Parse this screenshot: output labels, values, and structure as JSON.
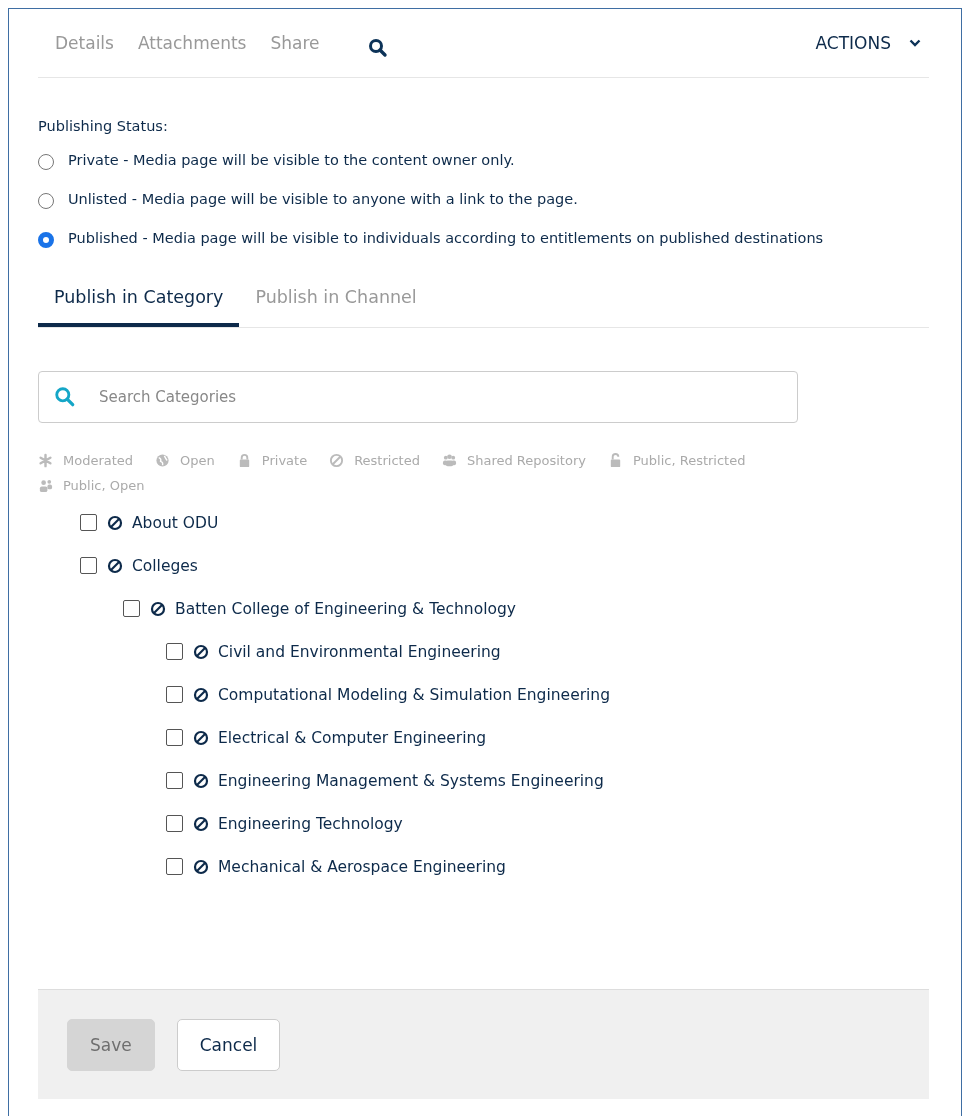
{
  "top_tabs": [
    {
      "label": "Details",
      "selected": false
    },
    {
      "label": "Attachments",
      "selected": false
    },
    {
      "label": "Share",
      "selected": false
    }
  ],
  "actions": {
    "label": "ACTIONS"
  },
  "publishing_status": {
    "label": "Publishing Status:",
    "options": [
      {
        "label": "Private - Media page will be visible to the content owner only.",
        "selected": false
      },
      {
        "label": "Unlisted - Media page will be visible to anyone with a link to the page.",
        "selected": false
      },
      {
        "label": "Published - Media page will be visible to individuals according to entitlements on published destinations",
        "selected": true
      }
    ]
  },
  "publish_tabs": [
    {
      "label": "Publish in Category",
      "selected": true
    },
    {
      "label": "Publish in Channel",
      "selected": false
    }
  ],
  "search": {
    "placeholder": "Search Categories"
  },
  "legend": [
    {
      "kind": "moderated",
      "label": "Moderated"
    },
    {
      "kind": "open",
      "label": "Open"
    },
    {
      "kind": "private",
      "label": "Private"
    },
    {
      "kind": "restricted",
      "label": "Restricted"
    },
    {
      "kind": "shared",
      "label": "Shared Repository"
    },
    {
      "kind": "public_restricted",
      "label": "Public, Restricted"
    },
    {
      "kind": "public_open",
      "label": "Public, Open"
    }
  ],
  "categories": [
    {
      "label": "About ODU",
      "kind": "restricted",
      "checked": false
    },
    {
      "label": "Colleges",
      "kind": "restricted",
      "checked": false,
      "children": [
        {
          "label": "Batten College of Engineering & Technology",
          "kind": "restricted",
          "checked": false,
          "children": [
            {
              "label": "Civil and Environmental Engineering",
              "kind": "restricted",
              "checked": false
            },
            {
              "label": "Computational Modeling & Simulation Engineering",
              "kind": "restricted",
              "checked": false
            },
            {
              "label": "Electrical & Computer Engineering",
              "kind": "restricted",
              "checked": false
            },
            {
              "label": "Engineering Management & Systems Engineering",
              "kind": "restricted",
              "checked": false
            },
            {
              "label": "Engineering Technology",
              "kind": "restricted",
              "checked": false
            },
            {
              "label": "Mechanical & Aerospace Engineering",
              "kind": "restricted",
              "checked": false
            }
          ]
        }
      ]
    }
  ],
  "buttons": [
    {
      "label": "Save",
      "disabled": true
    },
    {
      "label": "Cancel",
      "disabled": false
    }
  ]
}
